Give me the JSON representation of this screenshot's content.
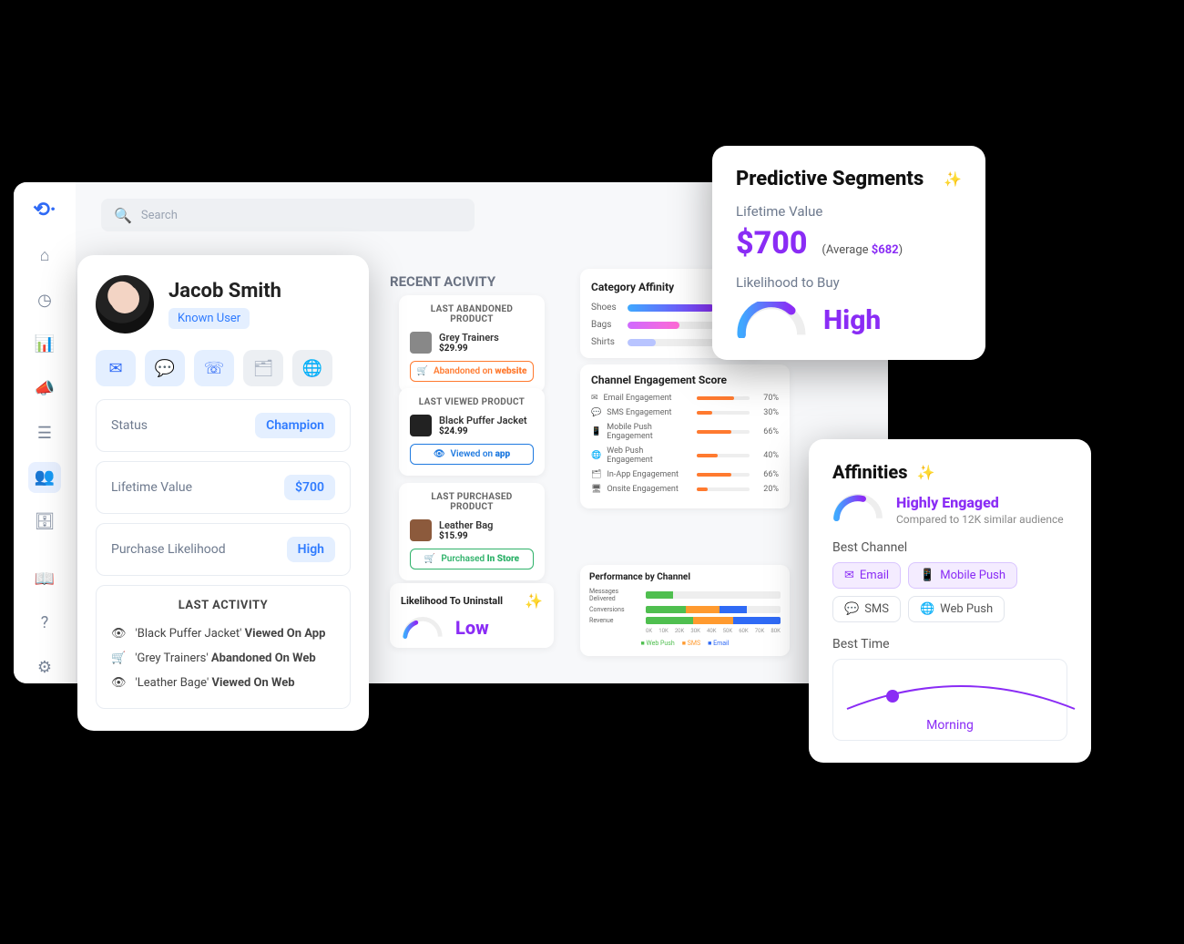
{
  "search": {
    "placeholder": "Search"
  },
  "profile": {
    "name": "Jacob Smith",
    "badge": "Known User",
    "stats": {
      "status_label": "Status",
      "status_value": "Champion",
      "ltv_label": "Lifetime Value",
      "ltv_value": "$700",
      "likelihood_label": "Purchase Likelihood",
      "likelihood_value": "High"
    },
    "last_activity": {
      "title": "LAST ACTIVITY",
      "items": [
        {
          "product": "'Black Puffer Jacket'",
          "action": "Viewed On App"
        },
        {
          "product": "'Grey Trainers'",
          "action": "Abandoned On Web"
        },
        {
          "product": "'Leather Bage'",
          "action": "Viewed On Web"
        }
      ]
    }
  },
  "recent": {
    "title": "RECENT ACIVITY",
    "abandoned": {
      "heading": "LAST ABANDONED PRODUCT",
      "name": "Grey Trainers",
      "price": "$29.99",
      "pill_pre": "Abandoned on ",
      "pill_strong": "website"
    },
    "viewed": {
      "heading": "LAST VIEWED PRODUCT",
      "name": "Black Puffer Jacket",
      "price": "$24.99",
      "pill_pre": "Viewed on ",
      "pill_strong": "app"
    },
    "purchased": {
      "heading": "LAST PURCHASED PRODUCT",
      "name": "Leather Bag",
      "price": "$15.99",
      "pill_pre": "Purchased ",
      "pill_strong": "In Store"
    }
  },
  "uninstall": {
    "title": "Likelihood To Uninstall",
    "value": "Low"
  },
  "category_affinity": {
    "title": "Category Affinity",
    "rows": [
      {
        "label": "Shoes",
        "pct": 90
      },
      {
        "label": "Bags",
        "pct": 54
      },
      {
        "label": "Shirts",
        "pct": 29
      }
    ]
  },
  "ces": {
    "title": "Channel Engagement Score",
    "rows": [
      {
        "label": "Email Engagement",
        "pct": 70
      },
      {
        "label": "SMS Engagement",
        "pct": 30
      },
      {
        "label": "Mobile Push Engagement",
        "pct": 66
      },
      {
        "label": "Web Push Engagement",
        "pct": 40
      },
      {
        "label": "In-App Engagement",
        "pct": 66
      },
      {
        "label": "Onsite Engagement",
        "pct": 20
      }
    ]
  },
  "performance": {
    "title": "Performance by Channel",
    "rows": [
      {
        "label": "Messages Delivered",
        "segs": [
          20,
          0,
          0
        ]
      },
      {
        "label": "Conversions",
        "segs": [
          30,
          25,
          20
        ]
      },
      {
        "label": "Revenue",
        "segs": [
          35,
          30,
          35
        ]
      }
    ],
    "axis": [
      "0K",
      "10K",
      "20K",
      "30K",
      "40K",
      "50K",
      "60K",
      "70K",
      "80K"
    ],
    "legend": [
      "Web Push",
      "SMS",
      "Email"
    ]
  },
  "predictive": {
    "title": "Predictive Segments",
    "ltv_label": "Lifetime Value",
    "ltv_value": "$700",
    "avg_pre": "(Average ",
    "avg_value": "$682",
    "avg_post": ")",
    "likely_label": "Likelihood to Buy",
    "likely_value": "High"
  },
  "affinities": {
    "title": "Affinities",
    "engaged_title": "Highly Engaged",
    "engaged_sub": "Compared to 12K similar audience",
    "best_channel_label": "Best Channel",
    "channels": [
      {
        "label": "Email",
        "primary": true
      },
      {
        "label": "Mobile Push",
        "primary": true
      },
      {
        "label": "SMS",
        "primary": false
      },
      {
        "label": "Web Push",
        "primary": false
      }
    ],
    "best_time_label": "Best Time",
    "best_time_value": "Morning"
  },
  "chart_data": [
    {
      "type": "bar",
      "title": "Category Affinity",
      "categories": [
        "Shoes",
        "Bags",
        "Shirts"
      ],
      "values": [
        90,
        54,
        29
      ],
      "xlabel": "",
      "ylabel": "%"
    },
    {
      "type": "bar",
      "title": "Channel Engagement Score",
      "categories": [
        "Email",
        "SMS",
        "Mobile Push",
        "Web Push",
        "In-App",
        "Onsite"
      ],
      "values": [
        70,
        30,
        66,
        40,
        66,
        20
      ],
      "xlabel": "",
      "ylabel": "%"
    },
    {
      "type": "bar",
      "title": "Performance by Channel",
      "categories": [
        "Messages Delivered",
        "Conversions",
        "Revenue"
      ],
      "series": [
        {
          "name": "Web Push",
          "values": [
            20,
            30,
            35
          ]
        },
        {
          "name": "SMS",
          "values": [
            0,
            25,
            30
          ]
        },
        {
          "name": "Email",
          "values": [
            0,
            20,
            35
          ]
        }
      ],
      "xlabel": "K",
      "ylabel": ""
    }
  ]
}
